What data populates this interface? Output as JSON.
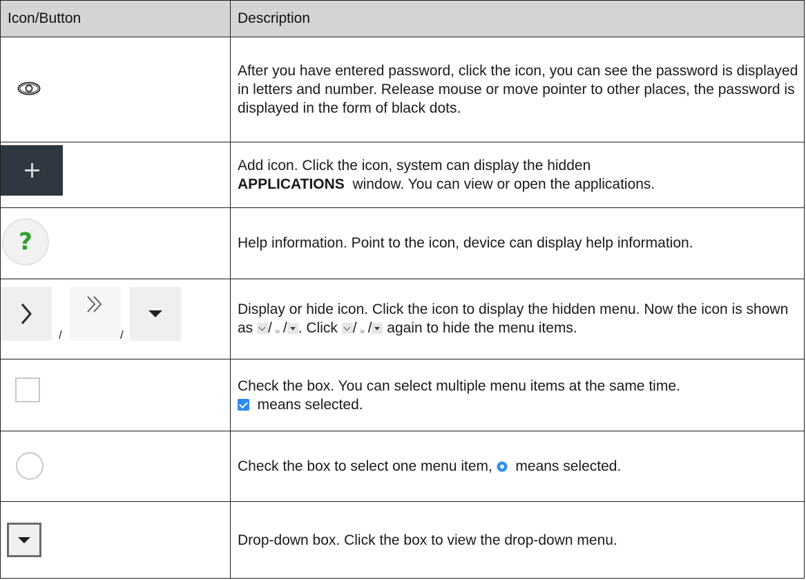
{
  "header": {
    "col1": "Icon/Button",
    "col2": "Description"
  },
  "rows": [
    {
      "icon": "eye-icon",
      "desc": "After you have entered password, click the icon, you can see the password is displayed in letters and number. Release mouse or move pointer to other places, the password is displayed in the form of black dots."
    },
    {
      "icon": "add-icon",
      "desc_a": "Add icon. Click the icon, system can display the hidden",
      "desc_bold": "APPLICATIONS",
      "desc_b": "window. You can view or open the applications."
    },
    {
      "icon": "help-icon",
      "glyph": "?",
      "desc": "Help information. Point to the icon, device can display help information."
    },
    {
      "icon": "display-hide-icon",
      "sep": "/",
      "desc_a": "Display or hide icon. Click the icon to display the hidden menu. Now the icon is shown as",
      "sep_inline": "/",
      "desc_b": ". Click",
      "desc_c": "again to hide the menu items."
    },
    {
      "icon": "checkbox-icon",
      "desc_a": "Check the box. You can select multiple menu items at the same time.",
      "desc_b": "means selected."
    },
    {
      "icon": "radio-icon",
      "desc_a": "Check the box to select one menu item,",
      "desc_b": "means selected."
    },
    {
      "icon": "dropdown-icon",
      "desc": "Drop-down box. Click the box to view the drop-down menu."
    }
  ],
  "colors": {
    "header_bg": "#d4d4d4",
    "add_bg": "#2f3740",
    "help_green": "#2ca02c",
    "accent_blue": "#2d8cf0"
  }
}
